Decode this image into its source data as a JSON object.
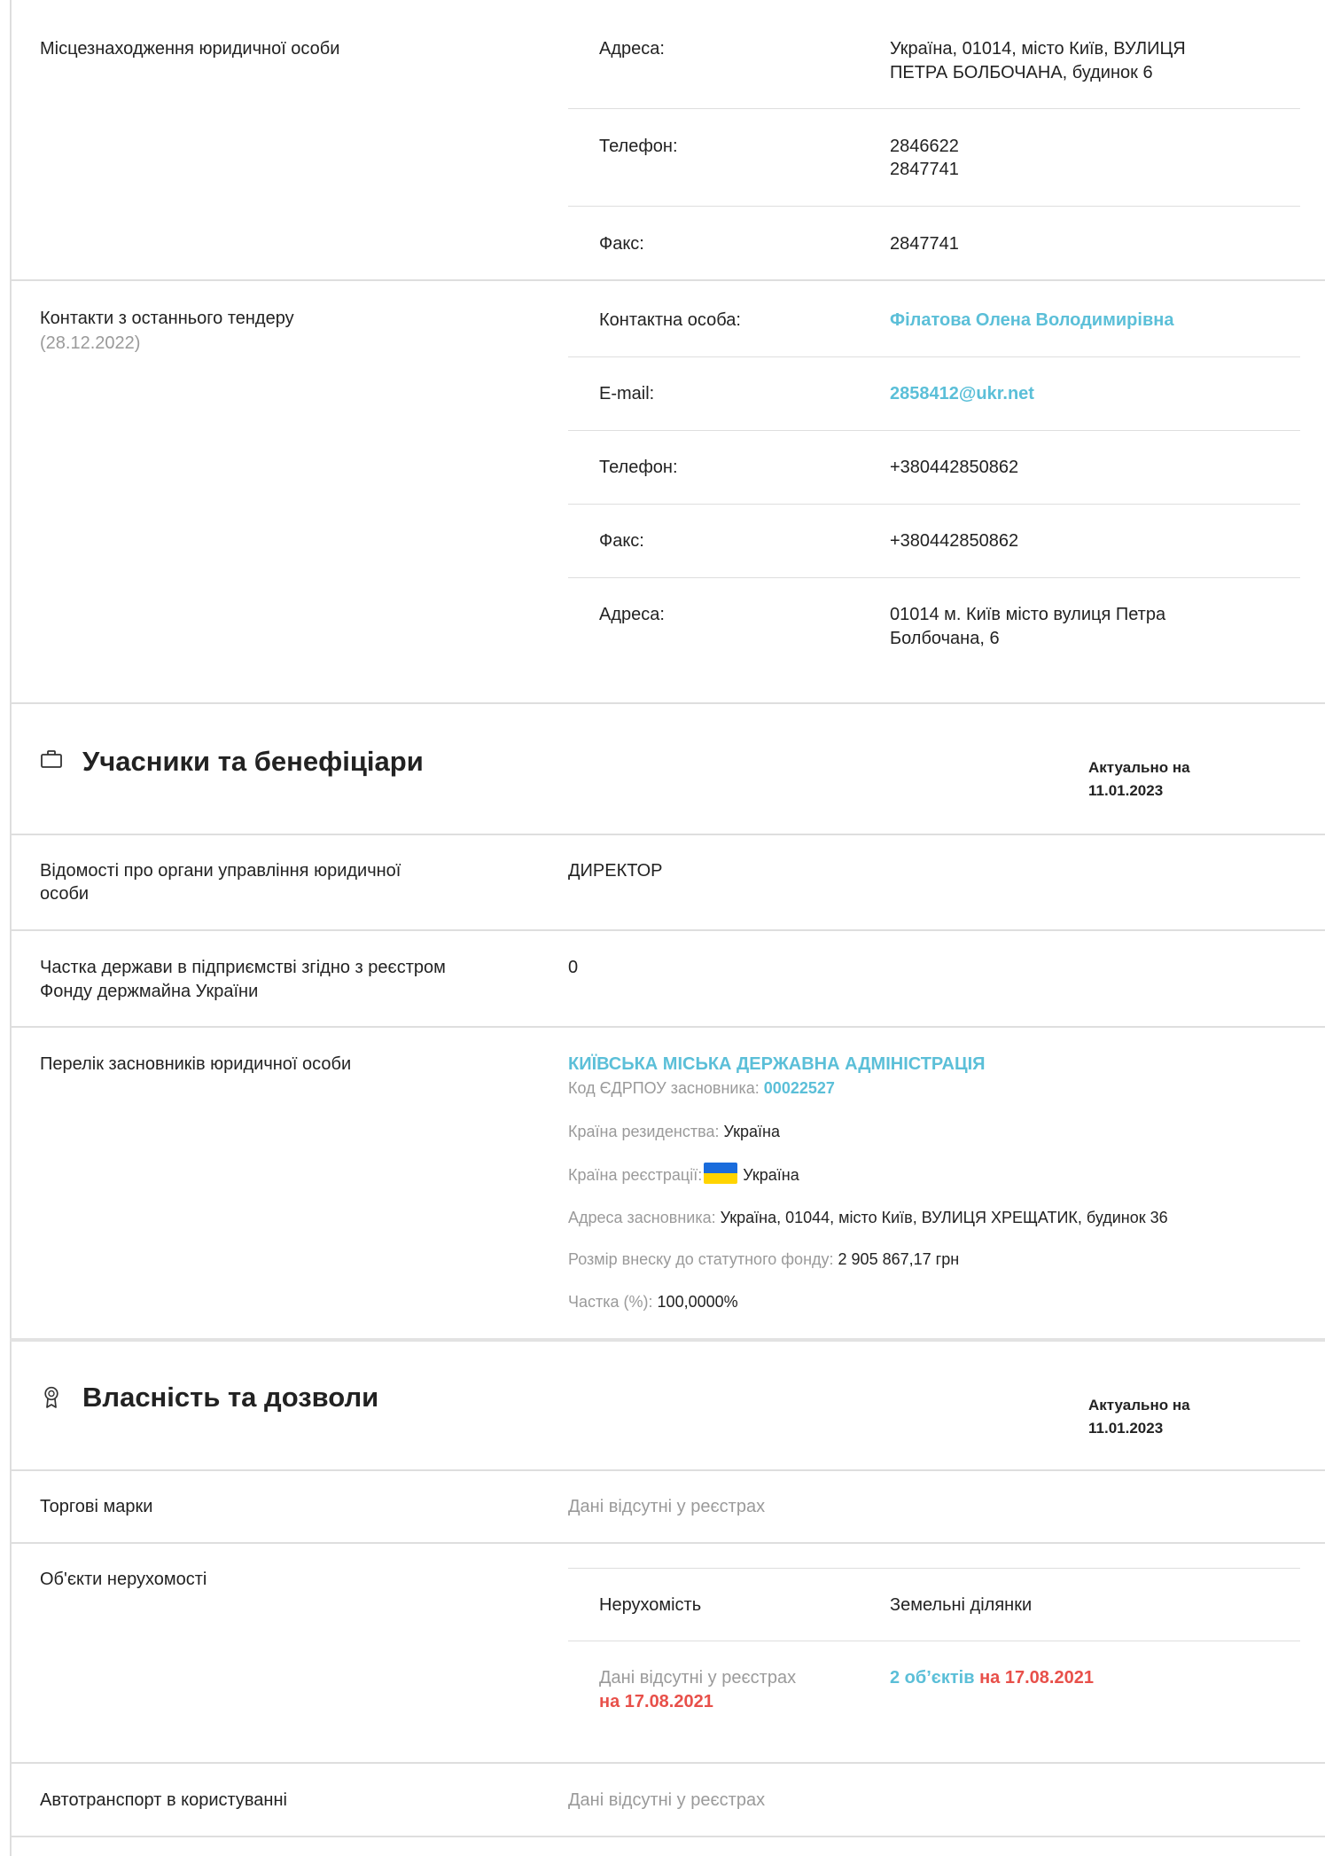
{
  "location": {
    "label": "Місцезнаходження юридичної особи",
    "rows": [
      {
        "key": "Адреса:",
        "lines": [
          "Україна, 01014, місто Київ, ВУЛИЦЯ",
          "ПЕТРА БОЛБОЧАНА, будинок 6"
        ]
      },
      {
        "key": "Телефон:",
        "lines": [
          "2846622",
          "2847741"
        ]
      },
      {
        "key": "Факс:",
        "lines": [
          "2847741"
        ]
      }
    ]
  },
  "contacts": {
    "label": "Контакти з останнього тендеру",
    "date": "(28.12.2022)",
    "rows": [
      {
        "key": "Контактна особа:",
        "value": "Філатова Олена Володимирівна"
      },
      {
        "key": "E-mail:",
        "value": "2858412@ukr.net"
      },
      {
        "key": "Телефон:",
        "value": "+380442850862"
      },
      {
        "key": "Факс:",
        "value": "+380442850862"
      },
      {
        "key": "Адреса:",
        "lines": [
          "01014 м. Київ місто вулиця Петра",
          "Болбочана, 6"
        ]
      }
    ]
  },
  "participants": {
    "title": "Учасники та бенефіціари",
    "icon": "briefcase-icon",
    "actual_label": "Актуально на",
    "actual_date": "11.01.2023",
    "management": {
      "label_lines": [
        "Відомості про органи управління юридичної",
        "особи"
      ],
      "value": "ДИРЕКТОР"
    },
    "state_share": {
      "label_lines": [
        "Частка держави в підприємстві згідно з реєстром",
        "Фонду держмайна України"
      ],
      "value": "0"
    },
    "founders": {
      "label": "Перелік засновників юридичної особи",
      "name": "КИЇВСЬКА МІСЬКА ДЕРЖАВНА АДМІНІСТРАЦІЯ",
      "code_label": "Код ЄДРПОУ засновника:",
      "code": "00022527",
      "residence_label": "Країна резиденства:",
      "residence": "Україна",
      "registration_label": "Країна реєстрації:",
      "registration": "Україна",
      "address_label": "Адреса засновника:",
      "address": "Україна, 01044, місто Київ, ВУЛИЦЯ ХРЕЩАТИК, будинок 36",
      "contribution_label": "Розмір внеску до статутного фонду:",
      "contribution": "2 905 867,17 грн",
      "share_label": "Частка (%):",
      "share": "100,0000%"
    }
  },
  "property": {
    "title": "Власність та дозволи",
    "icon": "award-icon",
    "actual_label": "Актуально на",
    "actual_date": "11.01.2023",
    "trademarks": {
      "label": "Торгові марки",
      "value": "Дані відсутні у реєстрах"
    },
    "real_estate": {
      "label": "Об'єкти нерухомості",
      "col1_header": "Нерухомість",
      "col2_header": "Земельні ділянки",
      "col1_value": "Дані відсутні у реєстрах",
      "col1_date": "на 17.08.2021",
      "col2_count": "2 об’єктів",
      "col2_date": "на 17.08.2021"
    },
    "vehicles": {
      "label": "Автотранспорт в користуванні",
      "value": "Дані відсутні у реєстрах"
    }
  },
  "colors": {
    "accent_link": "#5bbfd8",
    "accent_red": "#e8504a",
    "border": "#dedede",
    "muted": "#9a9a9a"
  }
}
